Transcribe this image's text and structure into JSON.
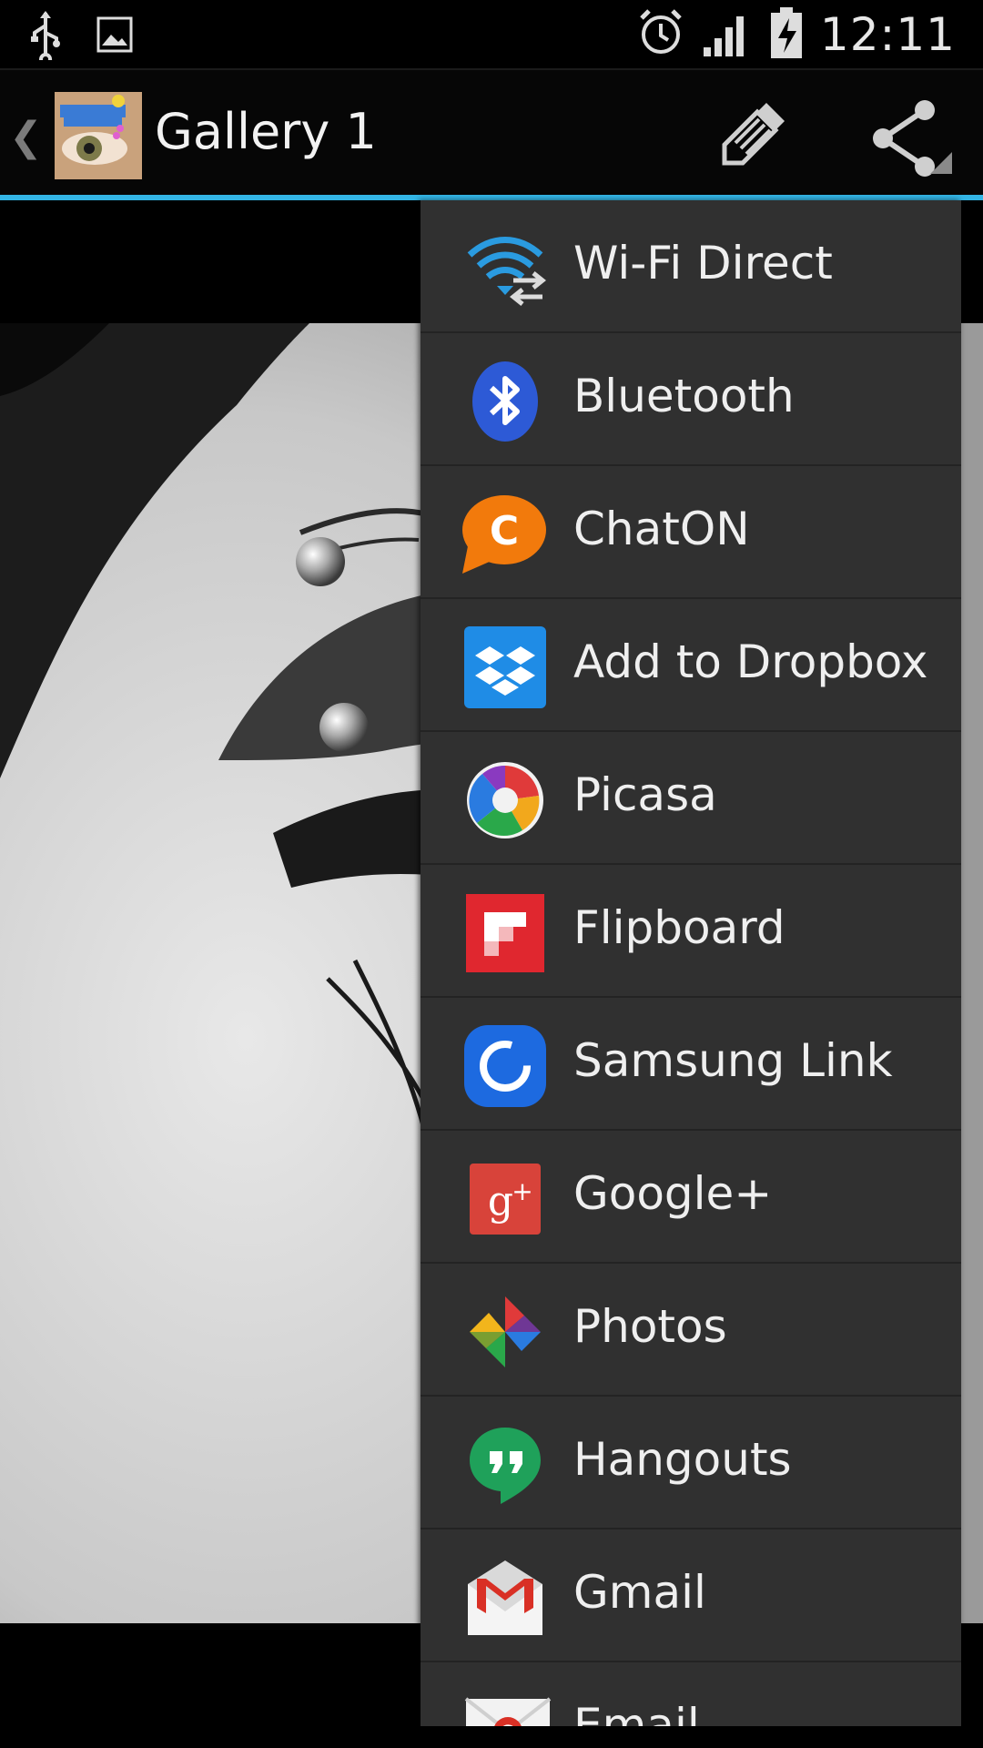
{
  "status_bar": {
    "time": "12:11",
    "icons": [
      "usb-icon",
      "image-icon",
      "alarm-icon",
      "signal-icon",
      "battery-charging-icon"
    ]
  },
  "action_bar": {
    "title": "Gallery 1",
    "up_icon": "back-caret-icon",
    "app_icon": "eyebrow-piercings-app-icon",
    "actions": [
      "edit-icon",
      "share-icon"
    ]
  },
  "share_menu": {
    "items": [
      {
        "label": "Wi-Fi Direct",
        "icon": "wifi-direct-icon"
      },
      {
        "label": "Bluetooth",
        "icon": "bluetooth-icon"
      },
      {
        "label": "ChatON",
        "icon": "chaton-icon"
      },
      {
        "label": "Add to Dropbox",
        "icon": "dropbox-icon"
      },
      {
        "label": "Picasa",
        "icon": "picasa-icon"
      },
      {
        "label": "Flipboard",
        "icon": "flipboard-icon"
      },
      {
        "label": "Samsung Link",
        "icon": "samsung-link-icon"
      },
      {
        "label": "Google+",
        "icon": "google-plus-icon"
      },
      {
        "label": "Photos",
        "icon": "photos-icon"
      },
      {
        "label": "Hangouts",
        "icon": "hangouts-icon"
      },
      {
        "label": "Gmail",
        "icon": "gmail-icon"
      },
      {
        "label": "Email",
        "icon": "email-icon"
      }
    ]
  },
  "colors": {
    "accent": "#33b5e5",
    "menu_bg": "#303030"
  }
}
